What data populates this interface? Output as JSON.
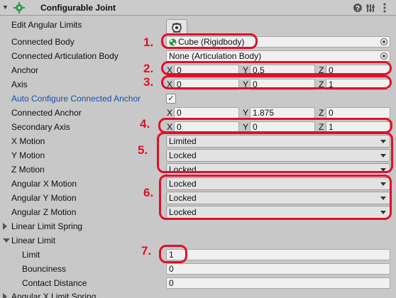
{
  "component": {
    "title": "Configurable Joint",
    "icons": [
      "joint-gear-icon",
      "help-icon",
      "preset-icon",
      "more-icon"
    ]
  },
  "rows": {
    "edit_angular_limits": "Edit Angular Limits",
    "connected_body": {
      "label": "Connected Body",
      "value": "Cube (Rigidbody)"
    },
    "connected_articulation_body": {
      "label": "Connected Articulation Body",
      "value": "None (Articulation Body)"
    },
    "anchor": {
      "label": "Anchor",
      "x": "0",
      "y": "0.5",
      "z": "0"
    },
    "axis": {
      "label": "Axis",
      "x": "0",
      "y": "0",
      "z": "1"
    },
    "auto_configure": {
      "label": "Auto Configure Connected Anchor",
      "checked": "✓"
    },
    "connected_anchor": {
      "label": "Connected Anchor",
      "x": "0",
      "y": "1.875",
      "z": "0"
    },
    "secondary_axis": {
      "label": "Secondary Axis",
      "x": "0",
      "y": "0",
      "z": "1"
    },
    "x_motion": {
      "label": "X Motion",
      "value": "Limited"
    },
    "y_motion": {
      "label": "Y Motion",
      "value": "Locked"
    },
    "z_motion": {
      "label": "Z Motion",
      "value": "Locked"
    },
    "angular_x_motion": {
      "label": "Angular X Motion",
      "value": "Locked"
    },
    "angular_y_motion": {
      "label": "Angular Y Motion",
      "value": "Locked"
    },
    "angular_z_motion": {
      "label": "Angular Z Motion",
      "value": "Locked"
    },
    "linear_limit_spring": "Linear Limit Spring",
    "linear_limit": "Linear Limit",
    "limit": {
      "label": "Limit",
      "value": "1"
    },
    "bounciness": {
      "label": "Bounciness",
      "value": "0"
    },
    "contact_distance": {
      "label": "Contact Distance",
      "value": "0"
    },
    "angular_x_limit_spring": "Angular X Limit Spring"
  },
  "axis_labels": {
    "x": "X",
    "y": "Y",
    "z": "Z"
  },
  "annotations": [
    "1.",
    "2.",
    "3.",
    "4.",
    "5.",
    "6.",
    "7."
  ],
  "colors": {
    "highlight": "#e0102a",
    "link_blue": "#1a4ea8",
    "panel_bg": "#c8c8c8"
  }
}
